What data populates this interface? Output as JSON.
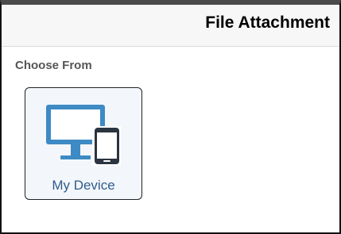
{
  "dialog": {
    "title": "File Attachment"
  },
  "choose": {
    "label": "Choose From",
    "options": [
      {
        "label": "My Device",
        "icon": "device-icon"
      }
    ]
  },
  "colors": {
    "icon_blue": "#3d8ac4",
    "icon_dark": "#2b3440",
    "label_blue": "#2f5d8a",
    "tile_bg": "#f3f6fb"
  }
}
